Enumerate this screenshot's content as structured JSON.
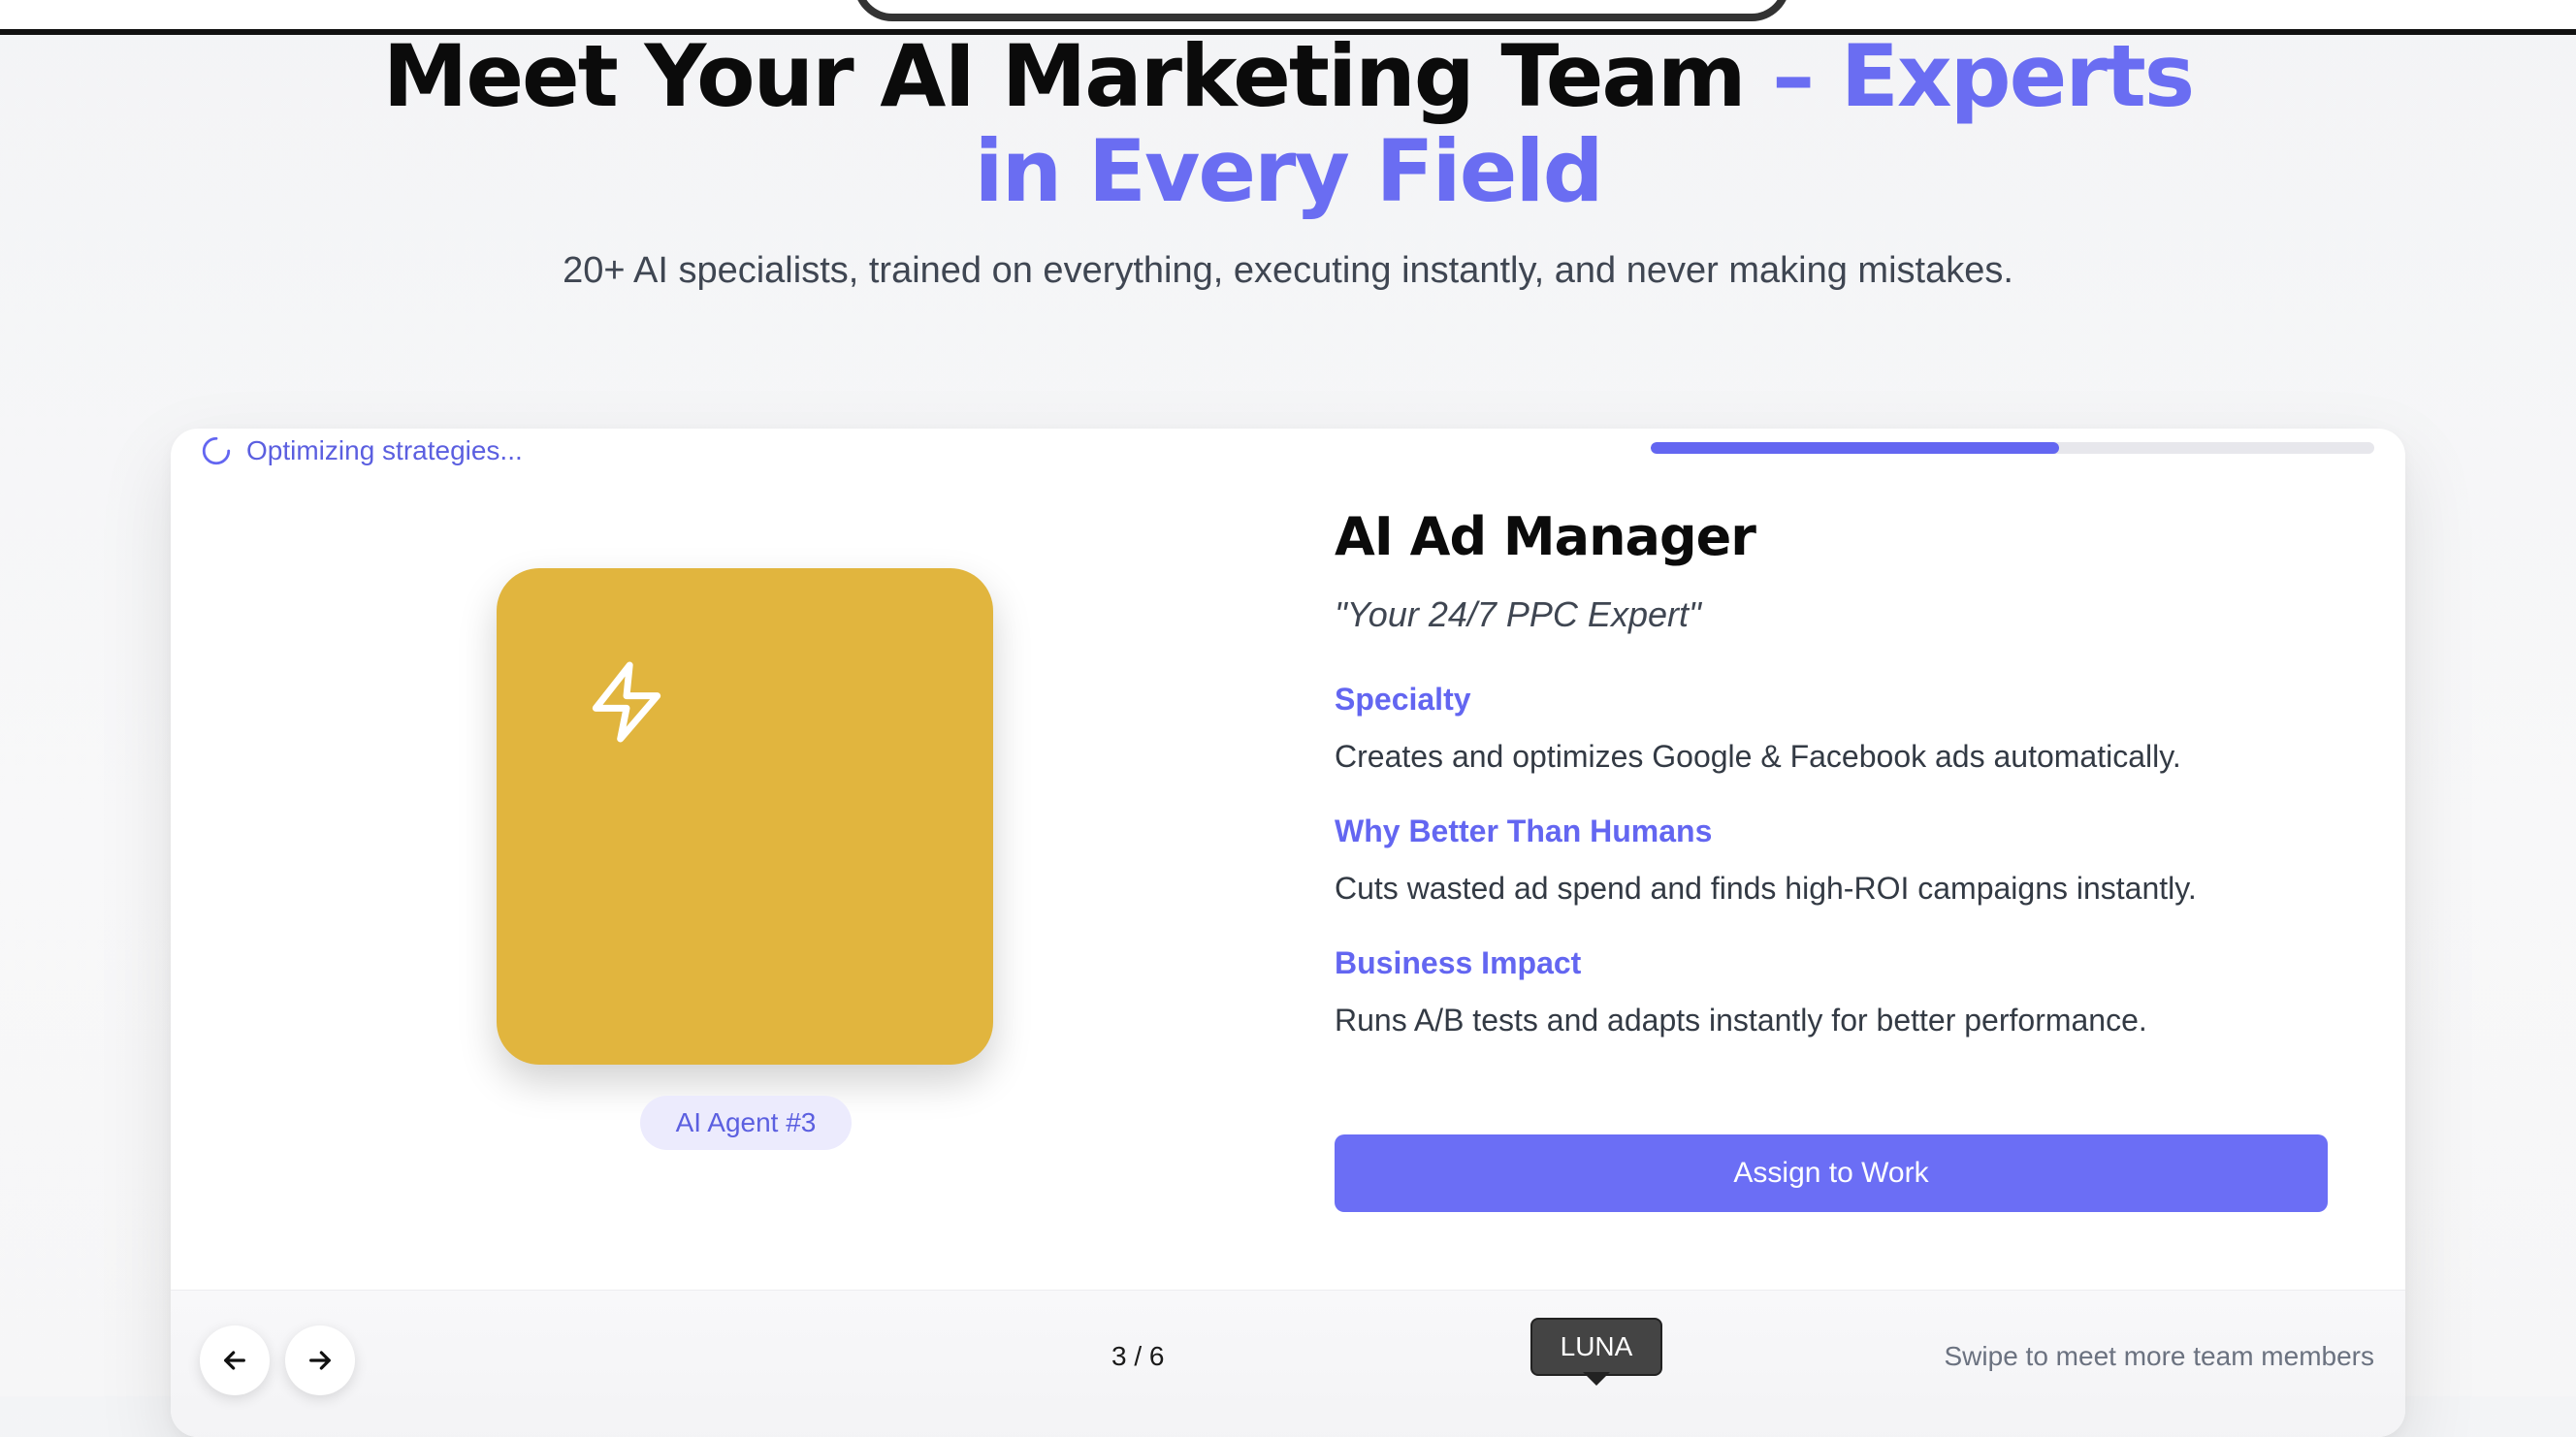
{
  "hero": {
    "title_main": "Meet Your AI Marketing Team",
    "title_accent_1": " – Experts",
    "title_accent_2": "in Every Field",
    "subtitle": "20+ AI specialists, trained on everything, executing instantly, and never making mistakes."
  },
  "card": {
    "status_text": "Optimizing strategies...",
    "progress_fraction": 0.565,
    "avatar_color": "#e1b53e",
    "avatar_icon": "lightning-bolt-icon",
    "agent_badge": "AI Agent #3",
    "agent_title": "AI Ad Manager",
    "agent_tagline": "\"Your 24/7 PPC Expert\"",
    "sections": [
      {
        "heading": "Specialty",
        "text": "Creates and optimizes Google & Facebook ads automatically."
      },
      {
        "heading": "Why Better Than Humans",
        "text": "Cuts wasted ad spend and finds high-ROI campaigns instantly."
      },
      {
        "heading": "Business Impact",
        "text": "Runs A/B tests and adapts instantly for better performance."
      }
    ],
    "assign_label": "Assign to Work"
  },
  "footer": {
    "prev_icon": "arrow-left-icon",
    "next_icon": "arrow-right-icon",
    "counter": "3 / 6",
    "tooltip": "LUNA",
    "swipe_hint": "Swipe to meet more team members"
  },
  "colors": {
    "accent": "#6366f1",
    "button": "#6b6ef5"
  }
}
